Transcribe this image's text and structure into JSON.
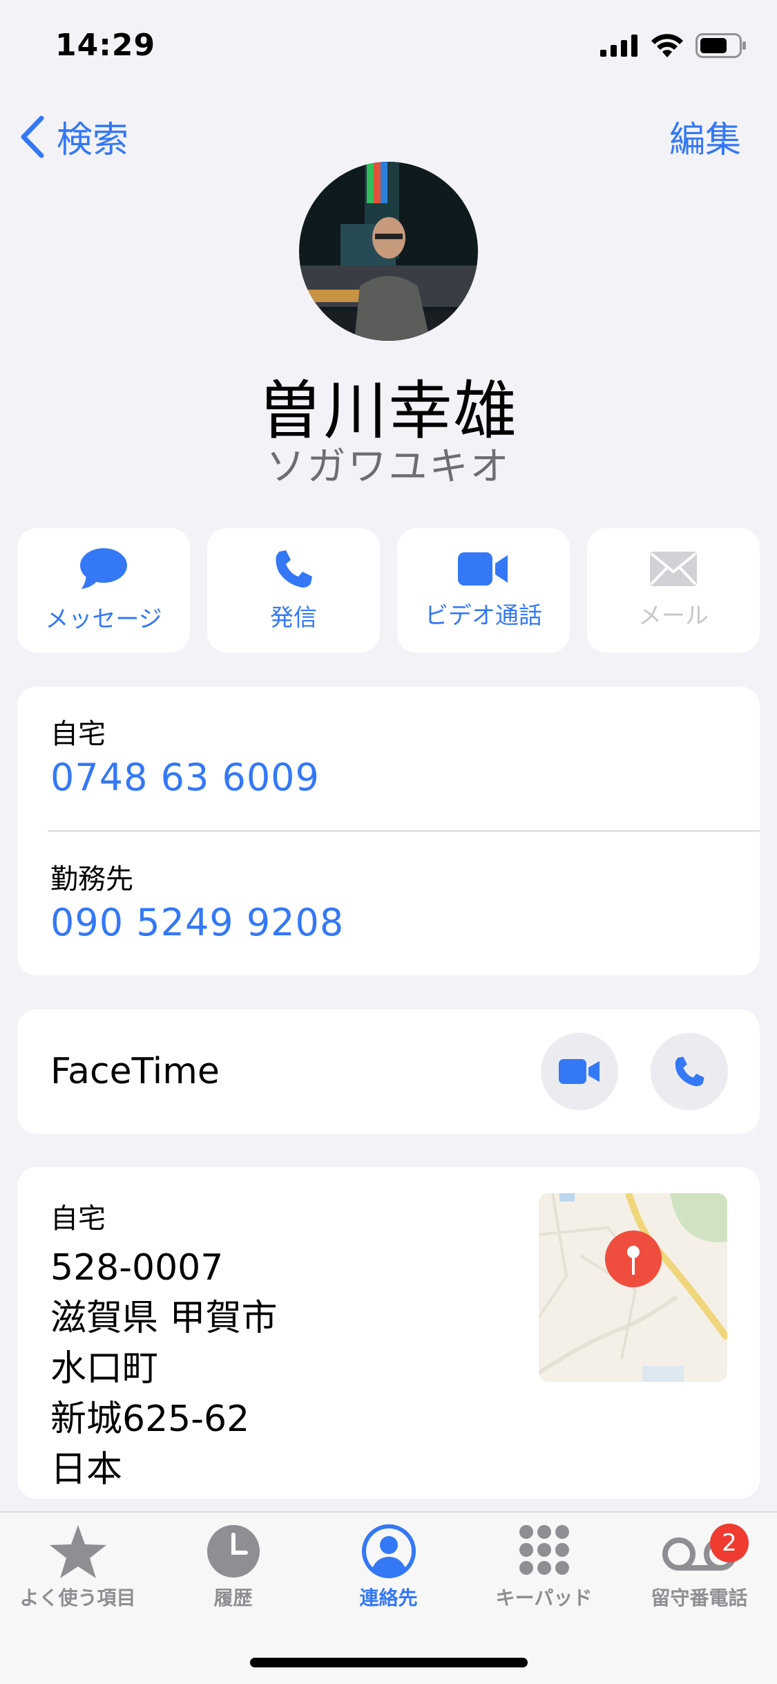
{
  "status": {
    "time": "14:29"
  },
  "nav": {
    "back_label": "検索",
    "edit_label": "編集"
  },
  "contact": {
    "name": "曽川幸雄",
    "kana": "ソガワユキオ"
  },
  "actions": [
    {
      "label": "メッセージ",
      "icon": "message-bubble-icon",
      "enabled": true
    },
    {
      "label": "発信",
      "icon": "phone-icon",
      "enabled": true
    },
    {
      "label": "ビデオ通話",
      "icon": "video-camera-icon",
      "enabled": true
    },
    {
      "label": "メール",
      "icon": "envelope-icon",
      "enabled": false
    }
  ],
  "phones": [
    {
      "label": "自宅",
      "number": "0748 63 6009"
    },
    {
      "label": "勤務先",
      "number": "090 5249 9208"
    }
  ],
  "facetime": {
    "label": "FaceTime"
  },
  "address": {
    "label": "自宅",
    "lines": [
      "528-0007",
      "滋賀県 甲賀市",
      "水口町",
      "新城625-62",
      "日本"
    ]
  },
  "tabs": [
    {
      "label": "よく使う項目",
      "icon": "star-icon"
    },
    {
      "label": "履歴",
      "icon": "clock-icon"
    },
    {
      "label": "連絡先",
      "icon": "person-circle-icon",
      "active": true
    },
    {
      "label": "キーパッド",
      "icon": "keypad-icon"
    },
    {
      "label": "留守番電話",
      "icon": "voicemail-icon",
      "badge": "2"
    }
  ],
  "colors": {
    "accent": "#3478f6",
    "badge": "#ef3b30",
    "background": "#f2f2f7"
  }
}
